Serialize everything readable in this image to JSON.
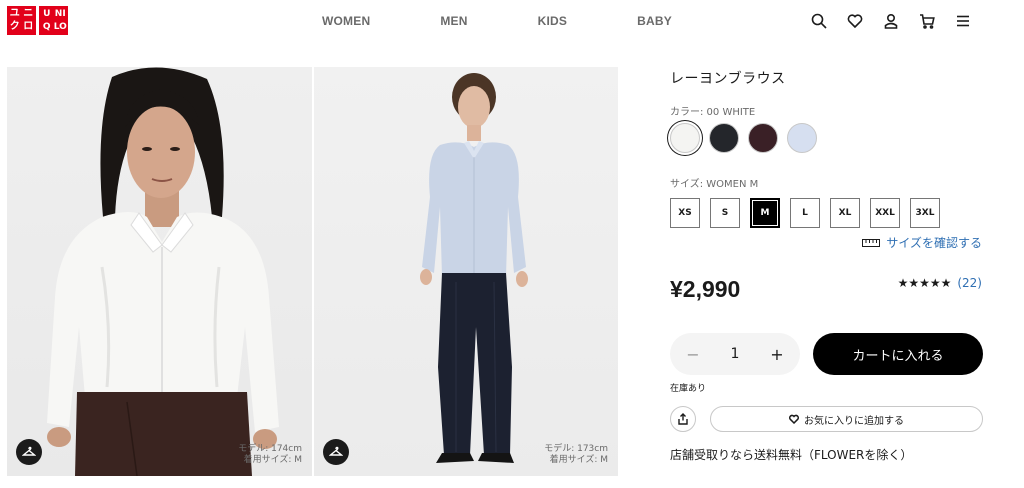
{
  "brand": {
    "logo_left": [
      "ユ",
      "ニ",
      "ク",
      "ロ"
    ],
    "logo_right": [
      "U",
      "NI",
      "Q",
      "LO"
    ],
    "logo_color": "#e2001a"
  },
  "nav": {
    "items": [
      "WOMEN",
      "MEN",
      "KIDS",
      "BABY"
    ]
  },
  "header_icons": [
    "search-icon",
    "heart-icon",
    "account-icon",
    "cart-icon",
    "menu-icon"
  ],
  "gallery": {
    "image1": {
      "model_height": "モデル: 174cm",
      "model_size": "着用サイズ: M",
      "shirt_color": "#f7f7f5",
      "pants_color": "#3a2420"
    },
    "image2": {
      "model_height": "モデル: 173cm",
      "model_size": "着用サイズ: M",
      "shirt_color": "#c9d4e6",
      "pants_color": "#1c2130"
    }
  },
  "product": {
    "name": "レーヨンブラウス",
    "color_label": "カラー: 00 WHITE",
    "colors": [
      {
        "name": "WHITE",
        "hex": "#f4f4f2",
        "selected": true
      },
      {
        "name": "BLACK",
        "hex": "#24262b",
        "selected": false
      },
      {
        "name": "DARK BROWN",
        "hex": "#3a2026",
        "selected": false
      },
      {
        "name": "LIGHT BLUE",
        "hex": "#d6dff0",
        "selected": false
      }
    ],
    "size_label": "サイズ: WOMEN M",
    "sizes": [
      "XS",
      "S",
      "M",
      "L",
      "XL",
      "XXL",
      "3XL"
    ],
    "selected_size": "M",
    "size_guide": "サイズを確認する",
    "price": "¥2,990",
    "stars": "★★★★★",
    "rating": 4.5,
    "review_count": "(22)",
    "quantity": "1",
    "qty_minus": "−",
    "qty_plus": "+",
    "cart_label": "カートに入れる",
    "stock": "在庫あり",
    "favorite_label": "お気に入りに追加する",
    "shipping": "店舗受取りなら送料無料（FLOWERを除く）"
  }
}
